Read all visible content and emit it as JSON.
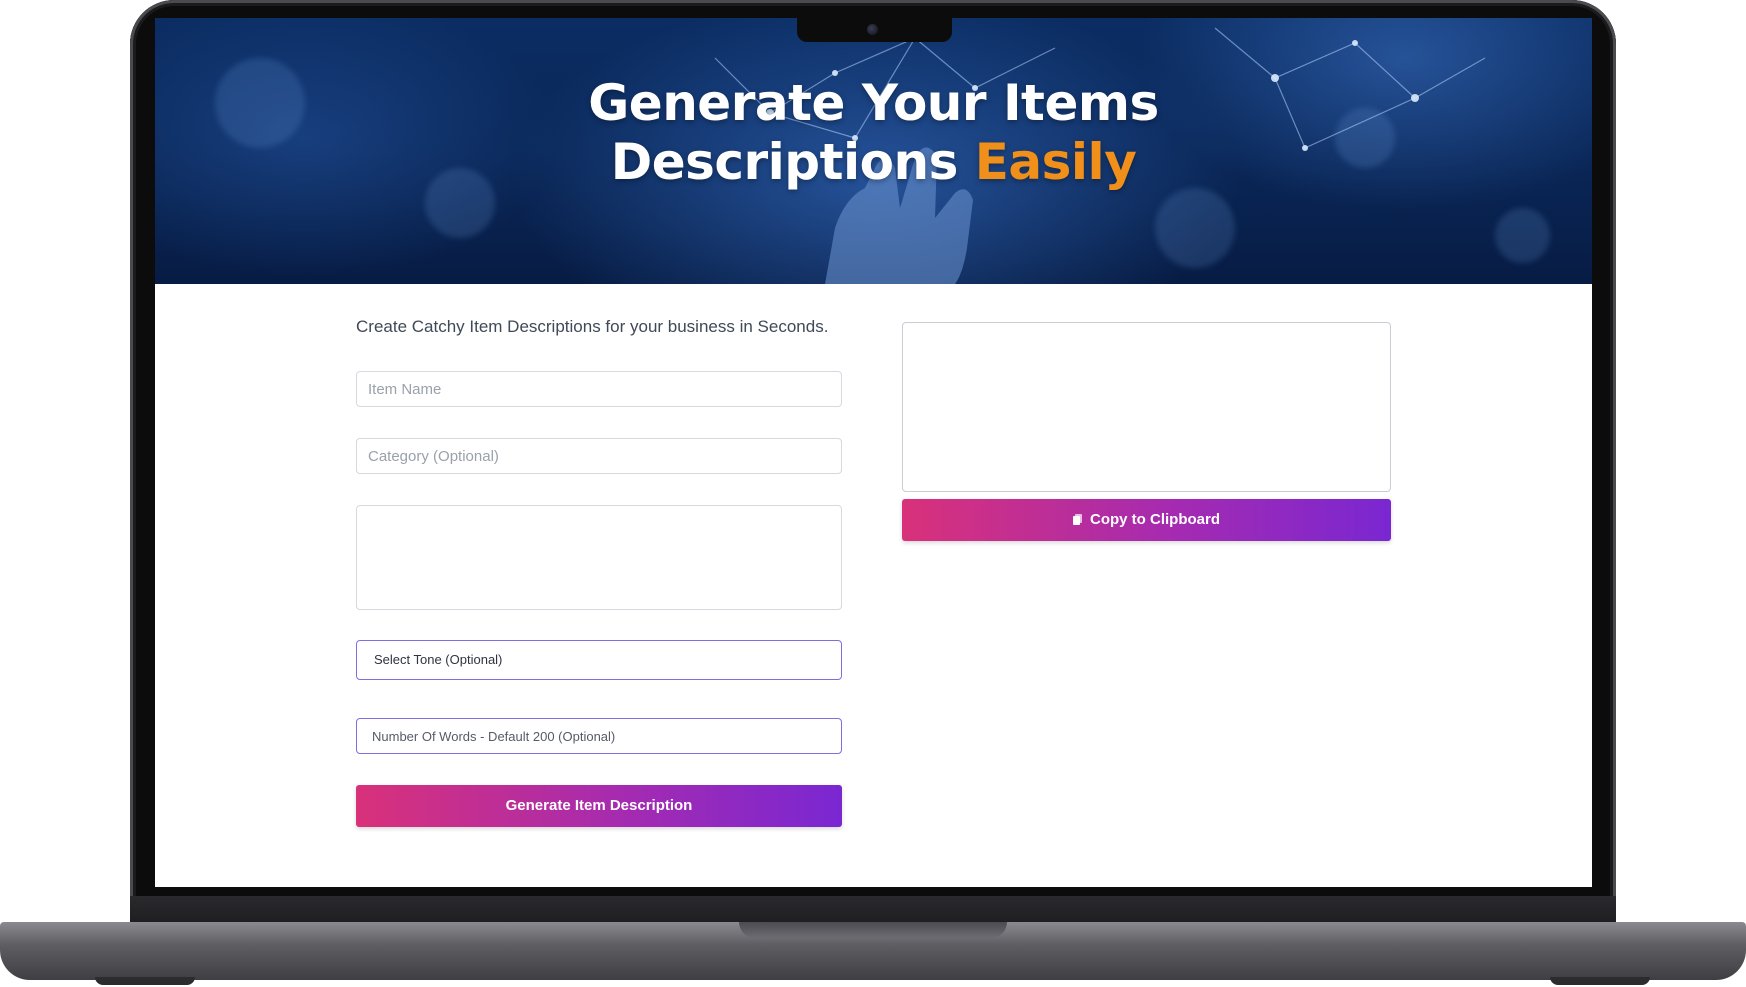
{
  "hero": {
    "title_line1": "Generate Your Items",
    "title_line2": "Descriptions",
    "title_accent": "Easily",
    "accent_color": "#f0901a"
  },
  "form": {
    "tagline": "Create Catchy Item Descriptions for your business in Seconds.",
    "item_name_placeholder": "Item Name",
    "category_placeholder": "Category (Optional)",
    "details_placeholder": "",
    "tone_select_label": "Select Tone (Optional)",
    "words_placeholder": "Number Of Words - Default 200 (Optional)",
    "generate_label": "Generate Item Description"
  },
  "output": {
    "value": "",
    "copy_label": "Copy to Clipboard",
    "copy_icon": "clipboard-icon"
  },
  "colors": {
    "button_gradient_start": "#d9317a",
    "button_gradient_end": "#7a27d2",
    "focus_border": "#7d6fe0"
  }
}
